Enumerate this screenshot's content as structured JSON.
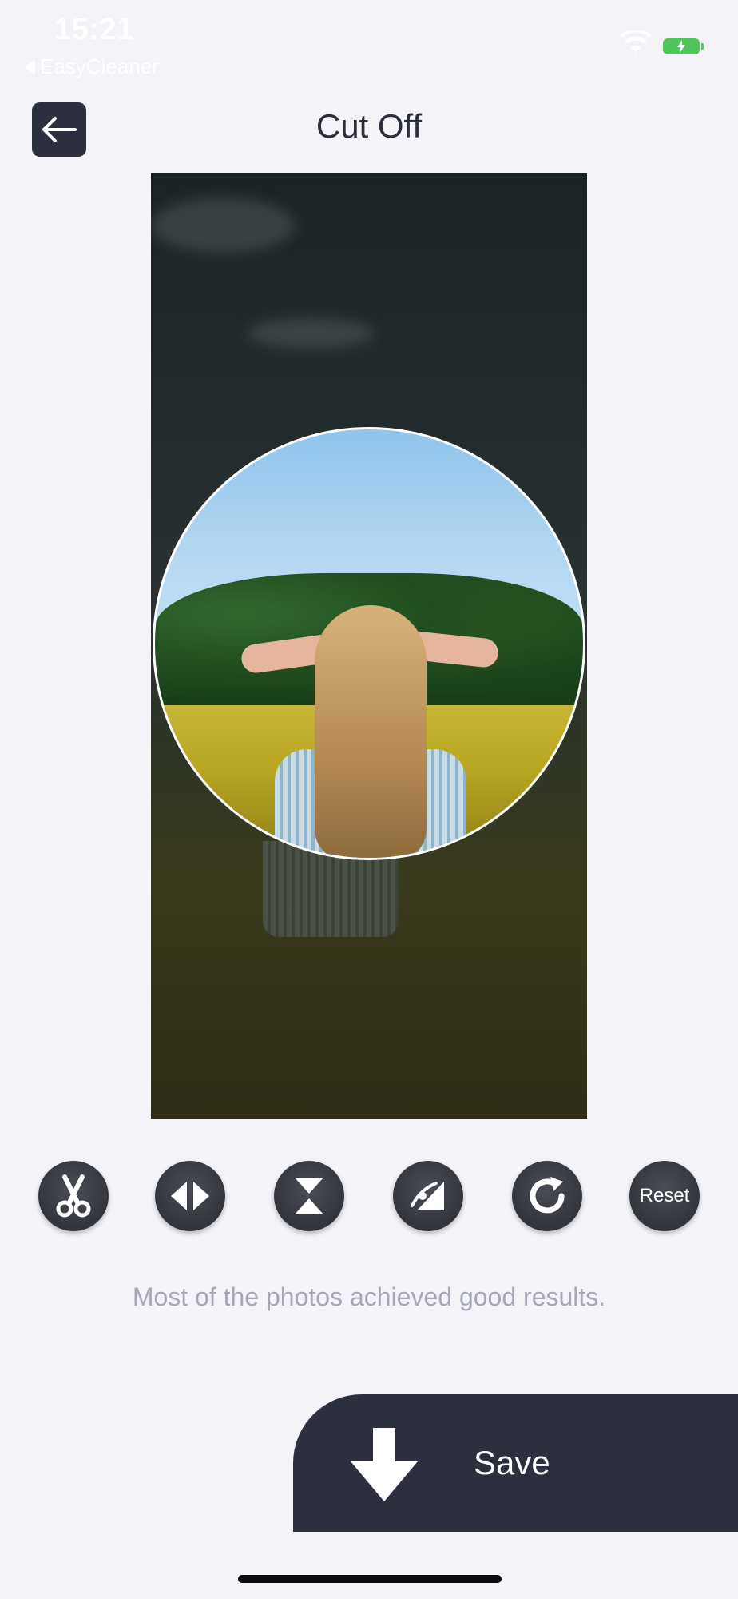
{
  "status_bar": {
    "time": "15:21",
    "back_app": "EasyCleaner"
  },
  "header": {
    "title": "Cut Off"
  },
  "tools": [
    {
      "name": "cut",
      "icon": "scissors-icon"
    },
    {
      "name": "flip-horizontal",
      "icon": "flip-horizontal-icon"
    },
    {
      "name": "flip-vertical",
      "icon": "flip-vertical-icon"
    },
    {
      "name": "adjust",
      "icon": "adjust-icon"
    },
    {
      "name": "rotate",
      "icon": "rotate-icon"
    },
    {
      "name": "reset",
      "label": "Reset"
    }
  ],
  "hint": "Most of the photos achieved good results.",
  "save": {
    "label": "Save",
    "icon": "download-arrow-icon"
  },
  "colors": {
    "background": "#f3f3f8",
    "dark": "#2c2f3d",
    "hint_text": "#a6a8b8",
    "battery": "#52c55a"
  }
}
